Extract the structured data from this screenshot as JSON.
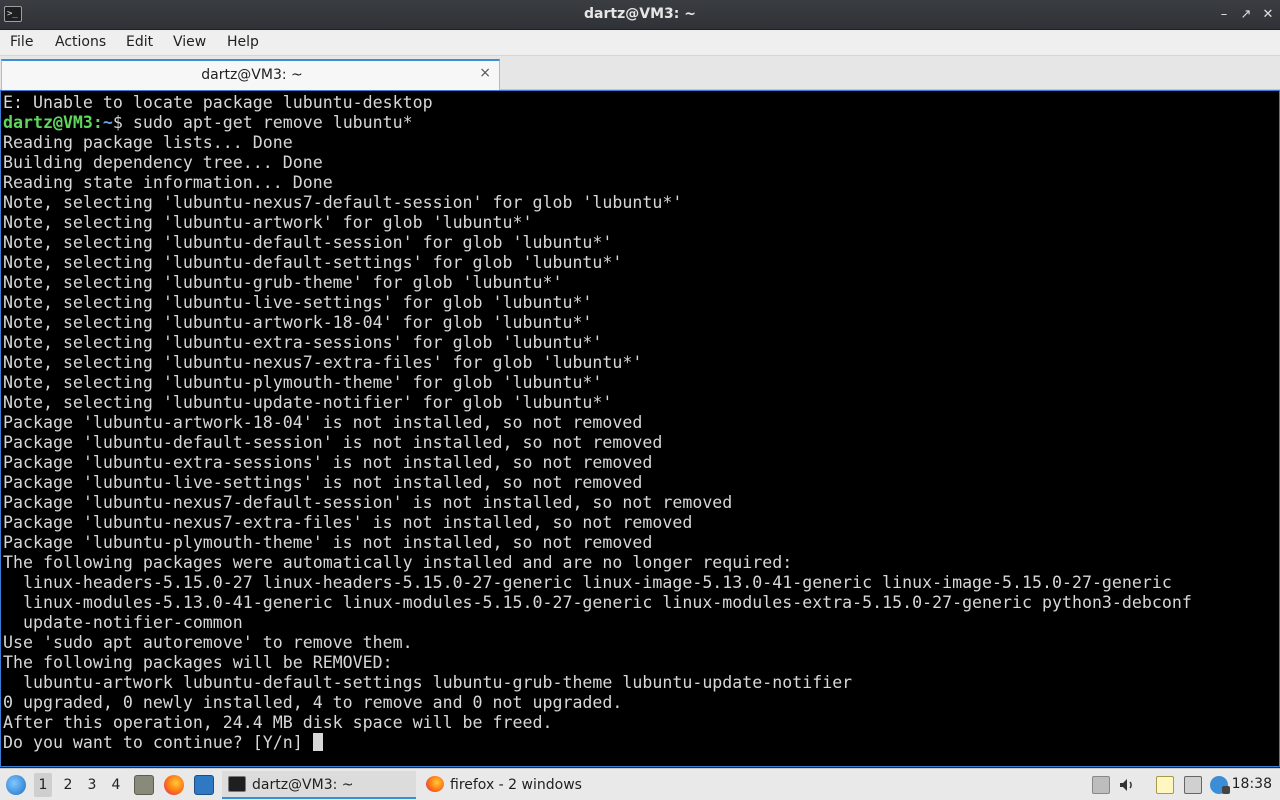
{
  "window": {
    "title": "dartz@VM3: ~",
    "app_icon": "terminal-icon",
    "controls": [
      "minimize-icon",
      "restore-icon",
      "close-icon"
    ]
  },
  "menu": [
    "File",
    "Actions",
    "Edit",
    "View",
    "Help"
  ],
  "tab": {
    "label": "dartz@VM3: ~",
    "close": "×"
  },
  "terminal": {
    "lines": [
      "E: Unable to locate package lubuntu-desktop",
      "Reading package lists... Done",
      "Building dependency tree... Done",
      "Reading state information... Done",
      "Note, selecting 'lubuntu-nexus7-default-session' for glob 'lubuntu*'",
      "Note, selecting 'lubuntu-artwork' for glob 'lubuntu*'",
      "Note, selecting 'lubuntu-default-session' for glob 'lubuntu*'",
      "Note, selecting 'lubuntu-default-settings' for glob 'lubuntu*'",
      "Note, selecting 'lubuntu-grub-theme' for glob 'lubuntu*'",
      "Note, selecting 'lubuntu-live-settings' for glob 'lubuntu*'",
      "Note, selecting 'lubuntu-artwork-18-04' for glob 'lubuntu*'",
      "Note, selecting 'lubuntu-extra-sessions' for glob 'lubuntu*'",
      "Note, selecting 'lubuntu-nexus7-extra-files' for glob 'lubuntu*'",
      "Note, selecting 'lubuntu-plymouth-theme' for glob 'lubuntu*'",
      "Note, selecting 'lubuntu-update-notifier' for glob 'lubuntu*'",
      "Package 'lubuntu-artwork-18-04' is not installed, so not removed",
      "Package 'lubuntu-default-session' is not installed, so not removed",
      "Package 'lubuntu-extra-sessions' is not installed, so not removed",
      "Package 'lubuntu-live-settings' is not installed, so not removed",
      "Package 'lubuntu-nexus7-default-session' is not installed, so not removed",
      "Package 'lubuntu-nexus7-extra-files' is not installed, so not removed",
      "Package 'lubuntu-plymouth-theme' is not installed, so not removed",
      "The following packages were automatically installed and are no longer required:",
      "  linux-headers-5.15.0-27 linux-headers-5.15.0-27-generic linux-image-5.13.0-41-generic linux-image-5.15.0-27-generic",
      "  linux-modules-5.13.0-41-generic linux-modules-5.15.0-27-generic linux-modules-extra-5.15.0-27-generic python3-debconf",
      "  update-notifier-common",
      "Use 'sudo apt autoremove' to remove them.",
      "The following packages will be REMOVED:",
      "  lubuntu-artwork lubuntu-default-settings lubuntu-grub-theme lubuntu-update-notifier",
      "0 upgraded, 0 newly installed, 4 to remove and 0 not upgraded.",
      "After this operation, 24.4 MB disk space will be freed."
    ],
    "prompt_user": "dartz@VM3:",
    "prompt_path": "~",
    "prompt_symbol": "$",
    "command": " sudo apt-get remove lubuntu*",
    "final_prompt": "Do you want to continue? [Y/n] "
  },
  "taskbar": {
    "start_icon": "lubuntu-start-icon",
    "desktops": [
      "1",
      "2",
      "3",
      "4"
    ],
    "active_desktop": "1",
    "quicklaunch": [
      "file-manager-icon",
      "firefox-icon",
      "show-desktop-icon"
    ],
    "tasks": [
      {
        "label": "dartz@VM3: ~",
        "icon": "terminal-icon",
        "active": true
      },
      {
        "label": "firefox - 2 windows",
        "icon": "firefox-icon",
        "active": false
      }
    ],
    "tray": [
      "network-eject-icon",
      "volume-icon",
      "clipboard-icon",
      "removable-media-icon",
      "update-notifier-icon",
      "display-icon"
    ],
    "clock": "18:38"
  },
  "colors": {
    "terminal_bg": "#000000",
    "terminal_fg": "#d7d7d7",
    "prompt_user": "#5fd75f",
    "prompt_path": "#6f9fe8",
    "accent": "#3b8ed6"
  }
}
